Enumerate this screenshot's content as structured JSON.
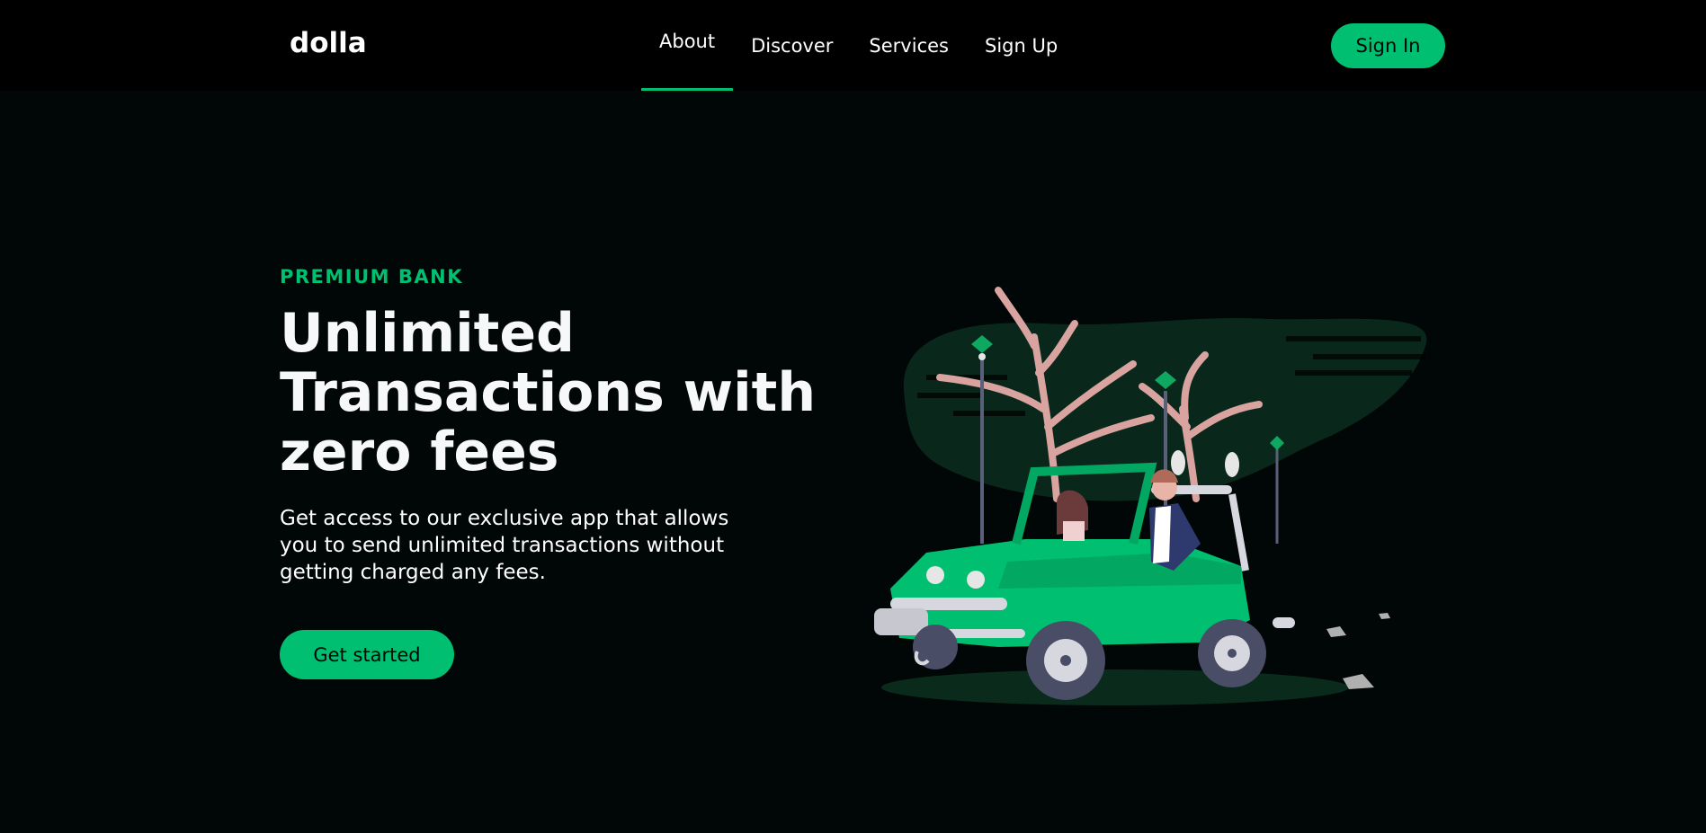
{
  "navbar": {
    "logo": "dolla",
    "links": [
      {
        "label": "About",
        "active": true
      },
      {
        "label": "Discover",
        "active": false
      },
      {
        "label": "Services",
        "active": false
      },
      {
        "label": "Sign Up",
        "active": false
      }
    ],
    "signin_label": "Sign In"
  },
  "hero": {
    "top_line": "PREMIUM BANK",
    "heading": "Unlimited Transactions with zero fees",
    "subtitle": "Get access to our exclusive app that allows you to send unlimited transactions without getting charged any fees.",
    "cta_label": "Get started"
  },
  "colors": {
    "accent": "#01bf71",
    "background": "#010606",
    "navbar": "#000000"
  },
  "icons": {
    "illustration": "car-trip-illustration"
  }
}
